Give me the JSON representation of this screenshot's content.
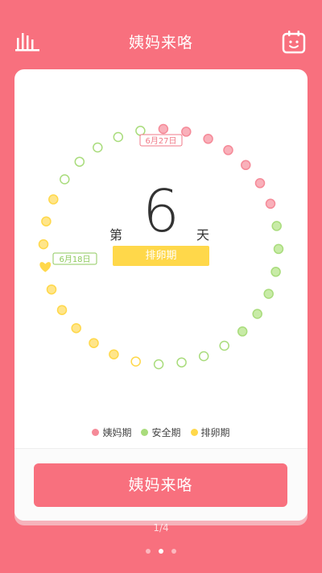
{
  "header": {
    "title": "姨妈来咯",
    "left_icon": "bar-chart-icon",
    "right_icon": "calendar-smile-icon"
  },
  "cycle": {
    "day_prefix": "第",
    "day_number": "6",
    "day_suffix": "天",
    "phase_label": "排卵期"
  },
  "markers": {
    "period_start": "6月27日",
    "safe_start": "6月18日"
  },
  "legend": {
    "items": [
      {
        "label": "姨妈期",
        "color": "#f58a98"
      },
      {
        "label": "安全期",
        "color": "#a9dc7c"
      },
      {
        "label": "排卵期",
        "color": "#ffd84a"
      }
    ]
  },
  "cta": {
    "label": "姨妈来咯"
  },
  "pager": {
    "text": "1/4",
    "active_index": 1,
    "count": 3
  },
  "colors": {
    "background": "#f8707e",
    "period": "#f58a98",
    "safe": "#a9dc7c",
    "ovulation": "#ffd84a"
  }
}
